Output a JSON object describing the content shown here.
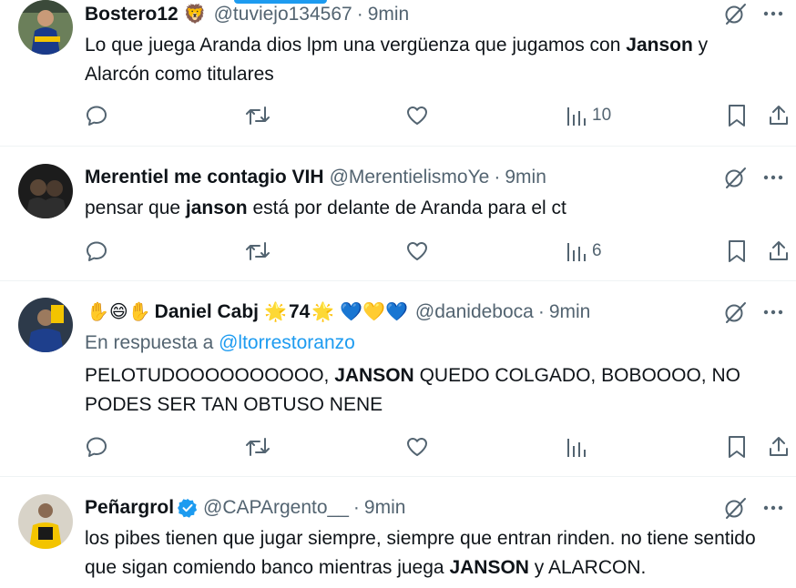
{
  "tweets": [
    {
      "name": "Bostero12",
      "name_emoji": "🦁",
      "handle": "@tuviejo134567",
      "separator": "·",
      "time": "9min",
      "text_parts": [
        {
          "t": "Lo que juega Aranda dios lpm una vergüenza que jugamos con ",
          "b": false
        },
        {
          "t": "Janson",
          "b": true
        },
        {
          "t": " y Alarcón como titulares",
          "b": false
        }
      ],
      "views": "10"
    },
    {
      "name": "Merentiel me contagio VIH",
      "handle": "@MerentielismoYe",
      "separator": "·",
      "time": "9min",
      "text_parts": [
        {
          "t": "pensar que ",
          "b": false
        },
        {
          "t": "janson",
          "b": true
        },
        {
          "t": " está por delante de Aranda para el ct",
          "b": false
        }
      ],
      "views": "6"
    },
    {
      "name_prefix_emoji": "✋😄✋",
      "name": "Daniel Cabj",
      "name_suffix": "74",
      "name_star": "🌟",
      "hearts": "💙💛💙",
      "handle": "@danideboca",
      "separator": "·",
      "time": "9min",
      "reply_label": "En respuesta a",
      "reply_mention": "@ltorrestoranzo",
      "text_parts": [
        {
          "t": "PELOTUDOOOOOOOOOO, ",
          "b": false
        },
        {
          "t": "JANSON",
          "b": true
        },
        {
          "t": " QUEDO COLGADO, BOBOOOO, NO PODES SER TAN OBTUSO NENE",
          "b": false
        }
      ],
      "views": ""
    },
    {
      "name": "Peñargrol",
      "handle": "@CAPArgento__",
      "separator": "·",
      "time": "9min",
      "text_parts": [
        {
          "t": "los pibes tienen que jugar siempre, siempre que entran rinden. no tiene sentido que sigan comiendo banco mientras juega ",
          "b": false
        },
        {
          "t": "JANSON",
          "b": true
        },
        {
          "t": " y ALARCON.",
          "b": false
        }
      ],
      "views": ""
    }
  ],
  "icons": {
    "grok": "grok-icon",
    "more": "more-icon",
    "reply": "reply-icon",
    "retweet": "retweet-icon",
    "like": "like-icon",
    "views": "views-icon",
    "bookmark": "bookmark-icon",
    "share": "share-icon",
    "verified": "verified-badge-icon"
  },
  "colors": {
    "text": "#0f1419",
    "secondary": "#536471",
    "link": "#1d9bf0",
    "divider": "#eff3f4"
  }
}
